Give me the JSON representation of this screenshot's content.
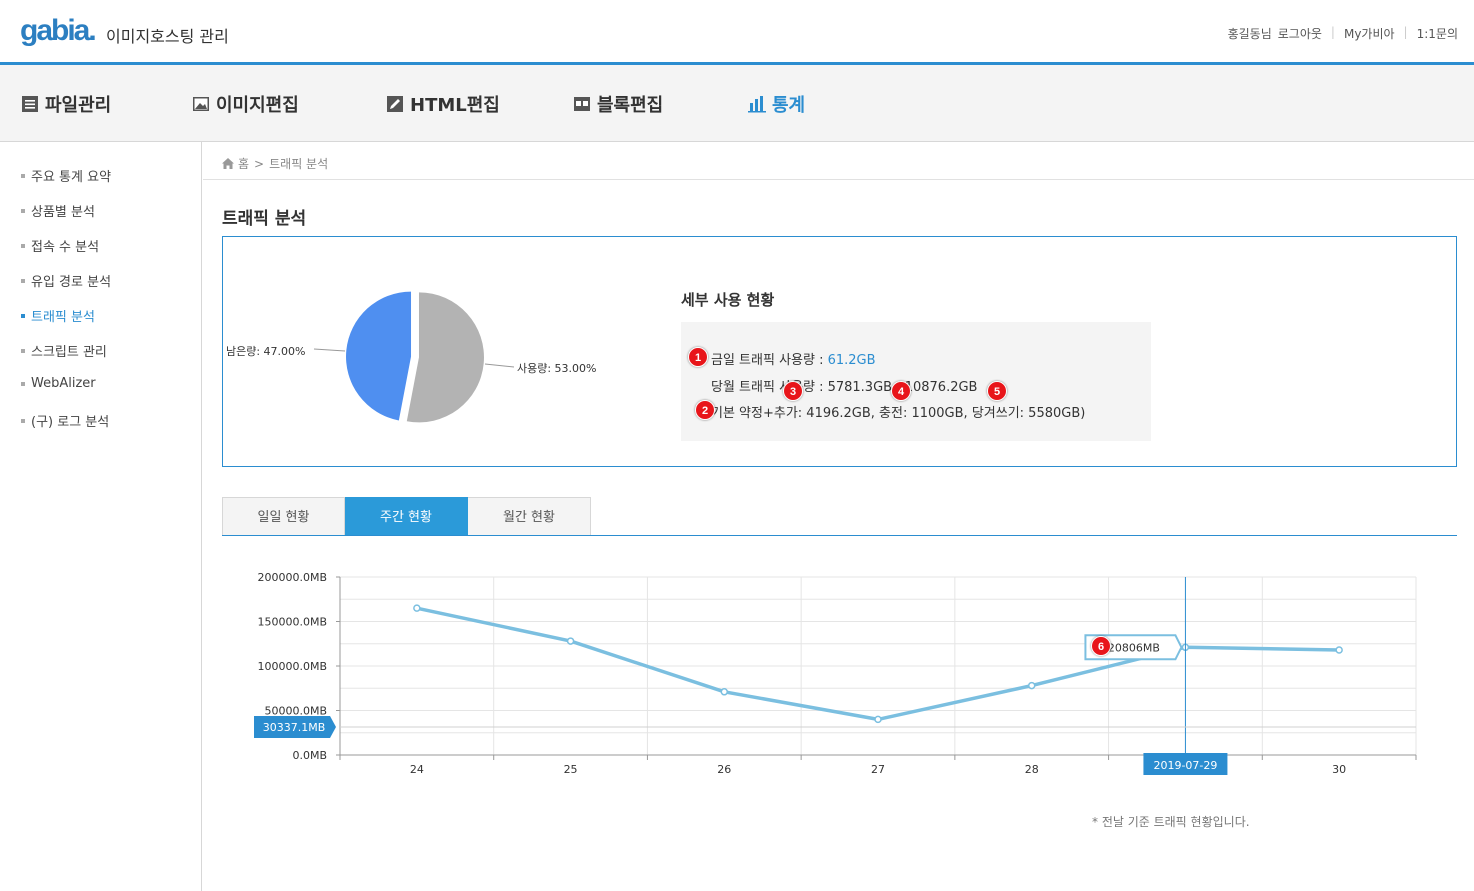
{
  "header": {
    "logo": "gabia",
    "logo_dot": ".",
    "app_title": "이미지호스팅 관리",
    "links": [
      "홍길동님",
      "로그아웃",
      "My가비아",
      "1:1문의"
    ]
  },
  "gnb": [
    {
      "label": "파일관리",
      "icon": "file-list-icon"
    },
    {
      "label": "이미지편집",
      "icon": "image-icon"
    },
    {
      "label": "HTML편집",
      "icon": "pencil-icon"
    },
    {
      "label": "블록편집",
      "icon": "block-icon"
    },
    {
      "label": "통계",
      "icon": "bar-chart-icon",
      "active": true
    }
  ],
  "sidebar": {
    "items": [
      {
        "label": "주요 통계 요약"
      },
      {
        "label": "상품별 분석"
      },
      {
        "label": "접속 수 분석"
      },
      {
        "label": "유입 경로 분석"
      },
      {
        "label": "트래픽 분석",
        "active": true
      },
      {
        "label": "스크립트 관리"
      },
      {
        "label": "WebAlizer"
      },
      {
        "label": "(구) 로그 분석"
      }
    ]
  },
  "breadcrumb": {
    "home": "홈",
    "separator": ">",
    "current": "트래픽 분석"
  },
  "page_title": "트래픽 분석",
  "pie": {
    "remaining_label": "남은량: 47.00%",
    "used_label": "사용량: 53.00%",
    "remaining_pct": 47.0,
    "used_pct": 53.0,
    "colors": {
      "remaining": "#4f8ff0",
      "used": "#b3b3b3"
    }
  },
  "detail": {
    "title": "세부 사용 현황",
    "today_label": "금일 트래픽 사용량 : ",
    "today_value": "61.2GB",
    "month_label": "당월 트래픽 사용량 : 5781.3GB / 10876.2GB",
    "plan_label": "기본 약정+추가: 4196.2GB, 충전: 1100GB, 당겨쓰기: 5580GB)"
  },
  "badges": [
    "1",
    "2",
    "3",
    "4",
    "5",
    "6"
  ],
  "tabs": [
    {
      "label": "일일 현황"
    },
    {
      "label": "주간 현황",
      "active": true
    },
    {
      "label": "월간 현황"
    }
  ],
  "chart_data": {
    "type": "line",
    "x": [
      "24",
      "25",
      "26",
      "27",
      "28",
      "29",
      "30"
    ],
    "x_tick_labels": [
      "24",
      "25",
      "26",
      "27",
      "28",
      "",
      "30"
    ],
    "series": [
      {
        "values": [
          165000,
          128000,
          71000,
          40000,
          78000,
          121000,
          118000
        ],
        "color": "#7bbfe0"
      }
    ],
    "y_ticks": [
      "0.0MB",
      "50000.0MB",
      "100000.0MB",
      "150000.0MB",
      "200000.0MB"
    ],
    "ylim": [
      0,
      200000
    ],
    "grid": true,
    "crosshair_x_label": "2019-07-29",
    "crosshair_y_label": "30337.1MB",
    "tooltip": "120806MB"
  },
  "note": "* 전날 기준 트래픽 현황입니다."
}
